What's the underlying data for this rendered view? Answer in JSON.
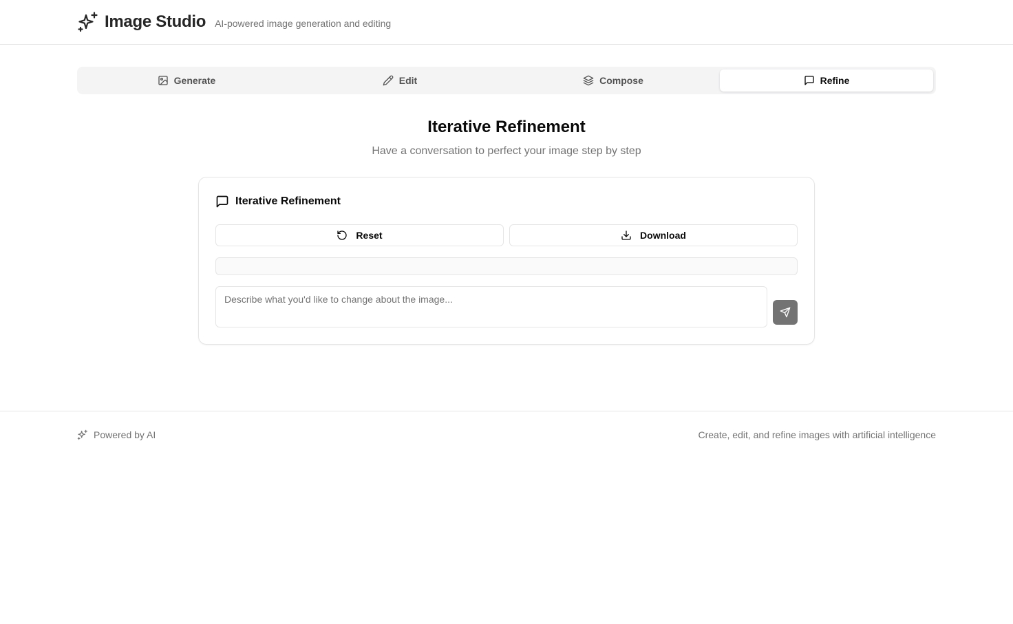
{
  "header": {
    "title": "Image Studio",
    "tagline": "AI-powered image generation and editing",
    "logo_icon": "sparkles-icon"
  },
  "tabs": [
    {
      "label": "Generate",
      "icon": "image-icon",
      "active": false
    },
    {
      "label": "Edit",
      "icon": "pencil-icon",
      "active": false
    },
    {
      "label": "Compose",
      "icon": "layers-icon",
      "active": false
    },
    {
      "label": "Refine",
      "icon": "message-square-icon",
      "active": true
    }
  ],
  "main": {
    "title": "Iterative Refinement",
    "subtitle": "Have a conversation to perfect your image step by step"
  },
  "card": {
    "title": "Iterative Refinement",
    "title_icon": "message-square-icon",
    "reset_label": "Reset",
    "download_label": "Download",
    "prompt_value": "",
    "prompt_placeholder": "Describe what you'd like to change about the image...",
    "send_icon": "send-icon"
  },
  "footer": {
    "left_text": "Powered by AI",
    "right_text": "Create, edit, and refine images with artificial intelligence"
  },
  "colors": {
    "accent": "#0a0a0a",
    "muted_text": "#737373",
    "border": "#e5e5e5",
    "tab_background": "#f4f4f5",
    "send_button": "#737373"
  }
}
